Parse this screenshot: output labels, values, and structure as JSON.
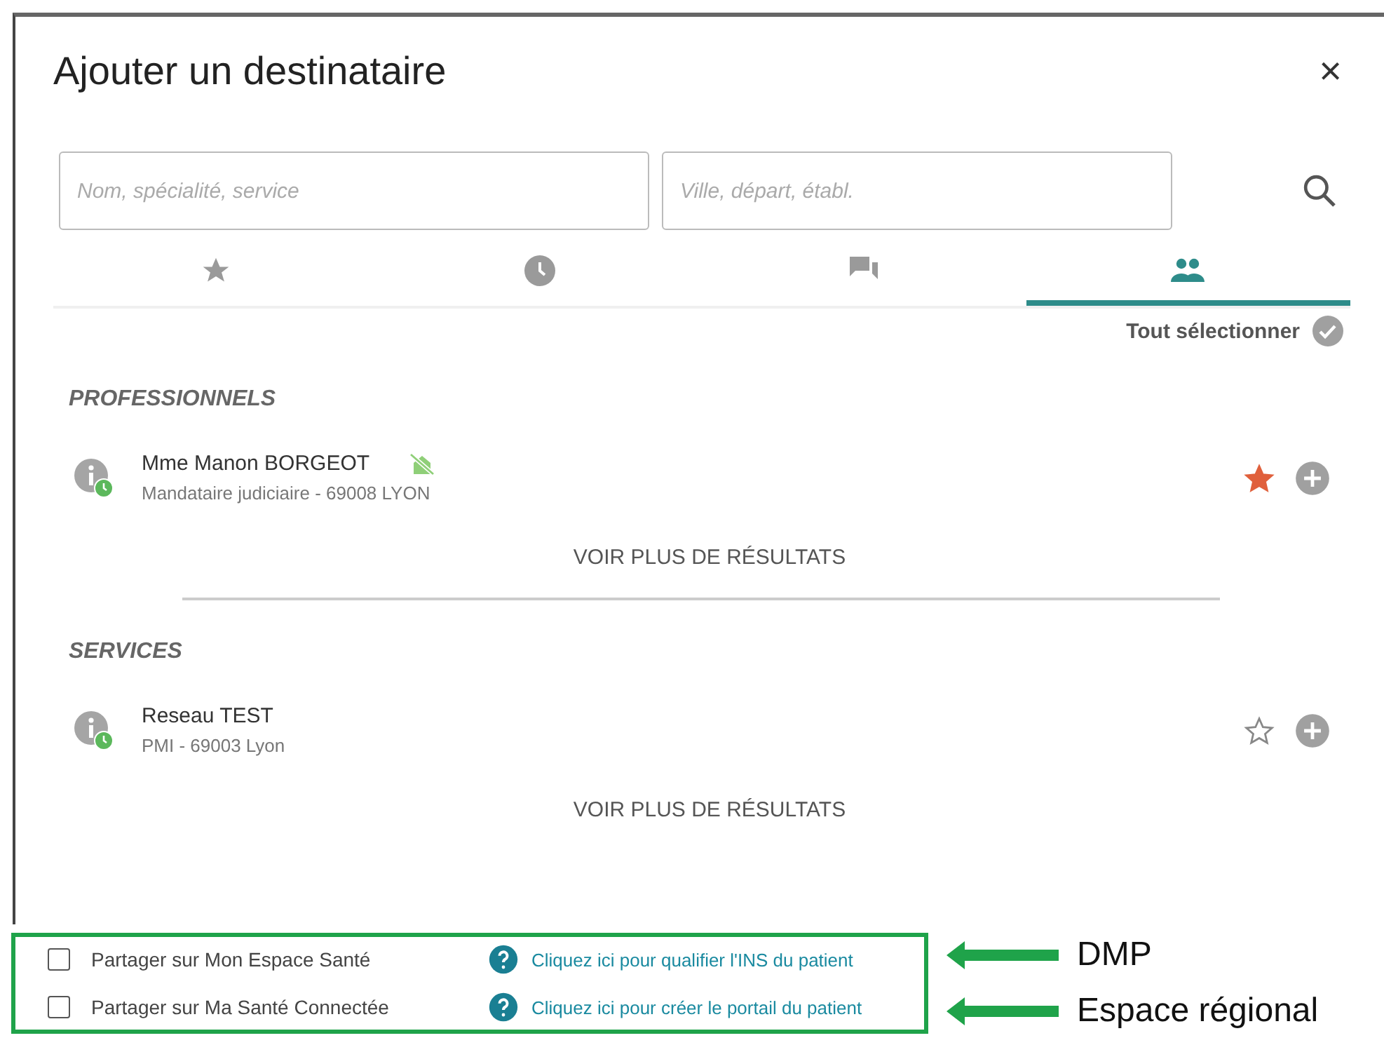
{
  "dialog": {
    "title": "Ajouter un destinataire",
    "close": "×"
  },
  "search": {
    "fields": [
      {
        "placeholder": "Nom, spécialité, service"
      },
      {
        "placeholder": "Ville, départ, établ."
      }
    ]
  },
  "tabs": [
    {
      "kind": "star",
      "selected": false
    },
    {
      "kind": "clock",
      "selected": false
    },
    {
      "kind": "chat",
      "selected": false
    },
    {
      "kind": "people",
      "selected": true
    }
  ],
  "select_all": "Tout sélectionner",
  "sections": [
    {
      "title": "PROFESSIONNELS",
      "results": [
        {
          "name": "Mme Manon BORGEOT",
          "detail": "Mandataire judiciaire - 69008 LYON",
          "badge": true,
          "favorite": true
        }
      ],
      "more": "VOIR PLUS DE RÉSULTATS"
    },
    {
      "title": "SERVICES",
      "results": [
        {
          "name": "Reseau TEST",
          "detail": "PMI - 69003 Lyon",
          "badge": false,
          "favorite": false
        }
      ],
      "more": "VOIR PLUS DE RÉSULTATS"
    }
  ],
  "share_options": [
    {
      "label": "Partager sur Mon Espace Santé",
      "checked": false,
      "link": "Cliquez ici pour qualifier l'INS du patient",
      "annotation": "DMP"
    },
    {
      "label": "Partager sur Ma Santé Connectée",
      "checked": false,
      "link": "Cliquez ici pour créer le portail du patient",
      "annotation": "Espace régional"
    }
  ]
}
